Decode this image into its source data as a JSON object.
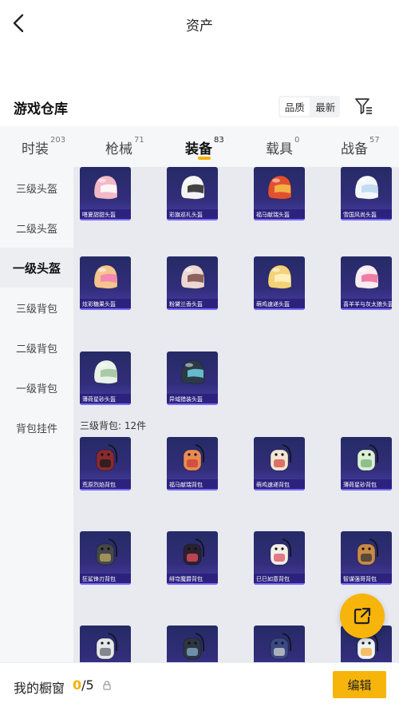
{
  "header": {
    "title": "资产"
  },
  "warehouse": {
    "title": "游戏仓库",
    "sort_options": [
      "品质",
      "最新"
    ]
  },
  "categories": [
    {
      "label": "时装",
      "count": "203"
    },
    {
      "label": "枪械",
      "count": "71"
    },
    {
      "label": "装备",
      "count": "83"
    },
    {
      "label": "载具",
      "count": "0"
    },
    {
      "label": "战备",
      "count": "57"
    }
  ],
  "sidebar": [
    "三级头盔",
    "二级头盔",
    "一级头盔",
    "三级背包",
    "二级背包",
    "一级背包",
    "背包挂件"
  ],
  "section_label": "三级背包: 12件",
  "helmets": [
    {
      "name": "嗒夏甜甜头盔",
      "color": "#f2b9c8",
      "accent": "#ffffff"
    },
    {
      "name": "彩旗巡礼头盔",
      "color": "#f4f4f4",
      "accent": "#222222"
    },
    {
      "name": "福马献瑞头盔",
      "color": "#e2502f",
      "accent": "#f5c24b"
    },
    {
      "name": "雪国风尚头盔",
      "color": "#f3f6fa",
      "accent": "#b8d7ee"
    },
    {
      "name": "炫彩糖果头盔",
      "color": "#f6c58f",
      "accent": "#f47eb7"
    },
    {
      "name": "粉黛兰香头盔",
      "color": "#ecd7d4",
      "accent": "#7b4b45"
    },
    {
      "name": "萌鸡速递头盔",
      "color": "#f5d277",
      "accent": "#fff4c8"
    },
    {
      "name": "喜羊羊与灰太狼头盔",
      "color": "#f7ecef",
      "accent": "#f06a9a"
    },
    {
      "name": "薄荷星砂头盔",
      "color": "#e9f2e8",
      "accent": "#9cc39a"
    },
    {
      "name": "异域猎装头盔",
      "color": "#2c3a46",
      "accent": "#6fd2e4"
    }
  ],
  "backpacks": [
    {
      "name": "荒原烈焰背包",
      "color": "#8a2a2e",
      "accent": "#1b1b1b"
    },
    {
      "name": "福马献瑞背包",
      "color": "#e98b52",
      "accent": "#c9443a"
    },
    {
      "name": "萌鸡速递背包",
      "color": "#f1e6d2",
      "accent": "#d9534f"
    },
    {
      "name": "薄荷星砂背包",
      "color": "#d9f0d4",
      "accent": "#7fb27a"
    },
    {
      "name": "狂鲨锋刃背包",
      "color": "#44474b",
      "accent": "#b9a25e"
    },
    {
      "name": "绯穹魔爵背包",
      "color": "#2b2230",
      "accent": "#e24b5b"
    },
    {
      "name": "巳巳如意背包",
      "color": "#f2efe9",
      "accent": "#e05a6a"
    },
    {
      "name": "智谋强哥背包",
      "color": "#c98a46",
      "accent": "#3e3a37"
    },
    {
      "name": "",
      "color": "#e6e7ea",
      "accent": "#6c6f75"
    },
    {
      "name": "",
      "color": "#2e3640",
      "accent": "#7ea6c7"
    },
    {
      "name": "",
      "color": "#3b4a83",
      "accent": "#c9c9c9"
    },
    {
      "name": "",
      "color": "#eef3f7",
      "accent": "#f3b244"
    }
  ],
  "showcase": {
    "label": "我的橱窗",
    "current": "0",
    "total": "/5",
    "edit_label": "编辑"
  },
  "accent_color": "#f5b100"
}
